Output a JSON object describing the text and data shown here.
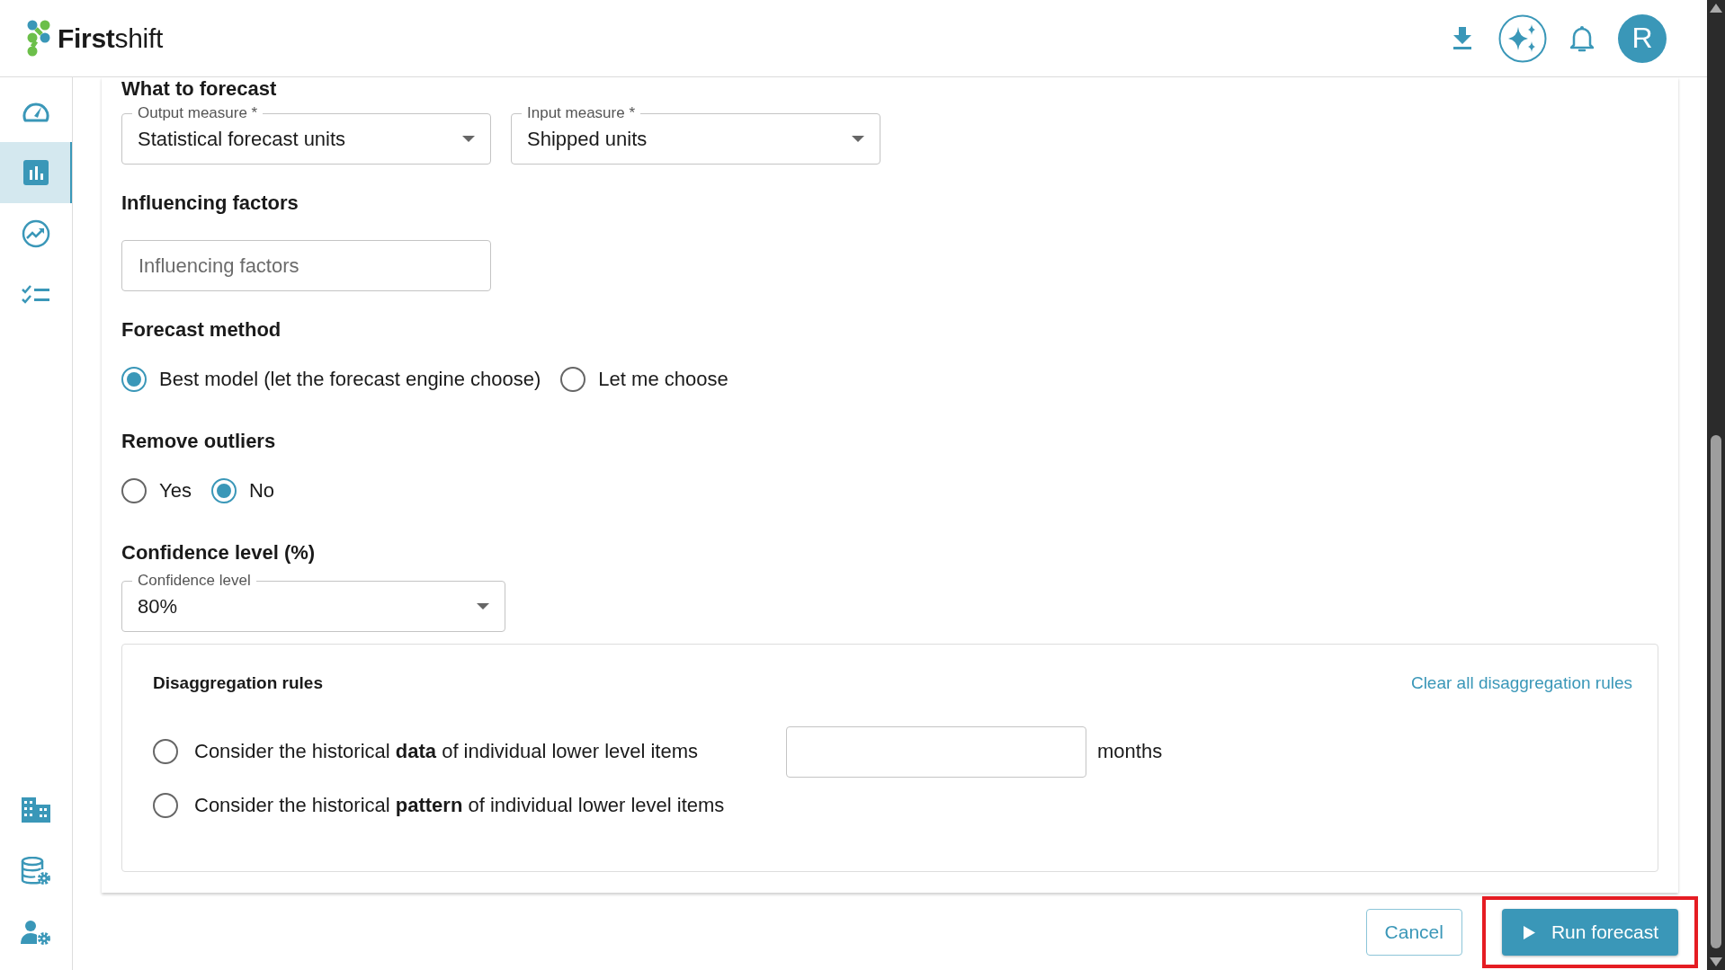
{
  "header": {
    "logo": {
      "bold": "First",
      "light": "shift"
    },
    "avatar": "R"
  },
  "sidebar": {
    "top_items": [
      {
        "kind": "gauge",
        "selected": false
      },
      {
        "kind": "chart",
        "selected": true
      },
      {
        "kind": "trend",
        "selected": false
      },
      {
        "kind": "checklist",
        "selected": false
      }
    ],
    "bottom_items": [
      {
        "kind": "building",
        "selected": false
      },
      {
        "kind": "database",
        "selected": false
      },
      {
        "kind": "user-settings",
        "selected": false
      }
    ]
  },
  "what_to_forecast": {
    "title": "What to forecast",
    "fields": [
      {
        "label": "Output measure *",
        "value": "Statistical forecast units"
      },
      {
        "label": "Input measure *",
        "value": "Shipped units"
      }
    ]
  },
  "influencing_factors": {
    "title": "Influencing factors",
    "placeholder": "Influencing factors"
  },
  "forecast_method": {
    "title": "Forecast method",
    "options": [
      {
        "label": "Best model (let the forecast engine choose)",
        "selected": true
      },
      {
        "label": "Let me choose",
        "selected": false
      }
    ]
  },
  "remove_outliers": {
    "title": "Remove outliers",
    "options": [
      {
        "label": "Yes",
        "selected": false
      },
      {
        "label": "No",
        "selected": true
      }
    ]
  },
  "confidence_level": {
    "title": "Confidence level (%)",
    "field": {
      "label": "Confidence level",
      "value": "80%"
    }
  },
  "disaggregation_rules": {
    "title": "Disaggregation rules",
    "clear_link": "Clear all disaggregation rules",
    "options": [
      {
        "label": "Consider the historical **data** of individual lower level items",
        "selected": false,
        "unit": "months"
      },
      {
        "label": "Consider the historical **pattern** of individual lower level items",
        "selected": false
      }
    ]
  },
  "buttons": [
    {
      "label": "Cancel",
      "kind": "secondary",
      "highlighted": false
    },
    {
      "label": "Run forecast",
      "kind": "primary",
      "highlighted": true
    }
  ]
}
